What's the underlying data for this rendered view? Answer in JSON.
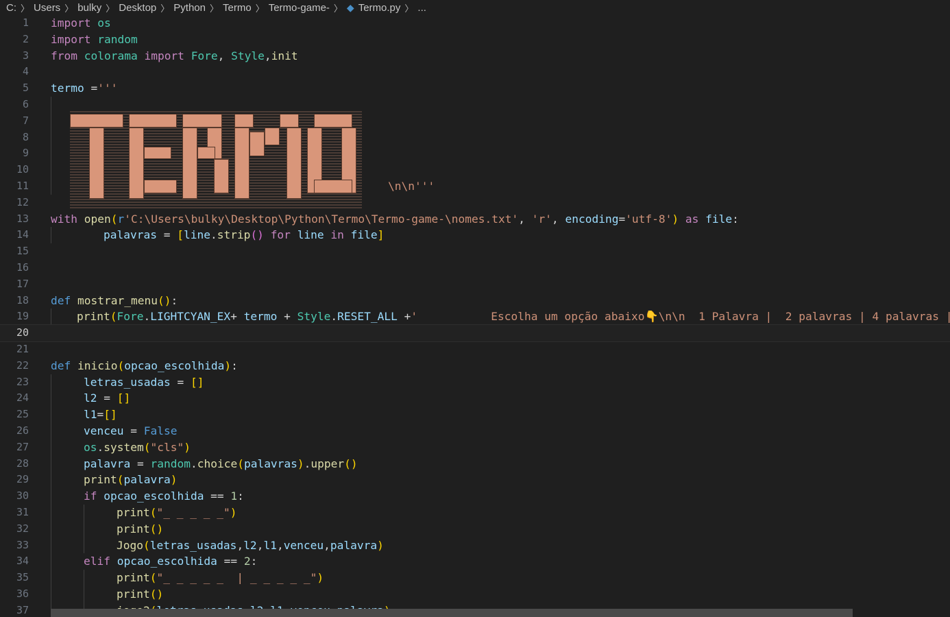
{
  "breadcrumb": {
    "items": [
      "C:",
      "Users",
      "bulky",
      "Desktop",
      "Python",
      "Termo",
      "Termo-game-"
    ],
    "file": "Termo.py",
    "ellipsis": "..."
  },
  "editor": {
    "active_line": 20,
    "line_numbers": [
      "1",
      "2",
      "3",
      "4",
      "5",
      "6",
      "7",
      "8",
      "9",
      "10",
      "11",
      "12",
      "13",
      "14",
      "15",
      "16",
      "17",
      "18",
      "19",
      "20",
      "21",
      "22",
      "23",
      "24",
      "25",
      "26",
      "27",
      "28",
      "29",
      "30",
      "31",
      "32",
      "33",
      "34",
      "35",
      "36",
      "37"
    ],
    "art_tail": "\\n\\n'''",
    "emoji_icon": "pointing-down-hand"
  }
}
